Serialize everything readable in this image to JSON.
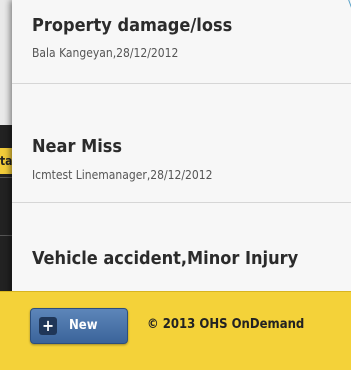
{
  "background": {
    "tab_text": "ta"
  },
  "incidents": [
    {
      "title": "Property damage/loss",
      "subtitle": "Bala Kangeyan,28/12/2012"
    },
    {
      "title": "Near Miss",
      "subtitle": "Icmtest Linemanager,28/12/2012"
    },
    {
      "title": "Vehicle accident,Minor Injury",
      "subtitle": ""
    }
  ],
  "footer": {
    "new_label": "New",
    "plus_glyph": "+",
    "copyright": "© 2013 OHS OnDemand"
  }
}
